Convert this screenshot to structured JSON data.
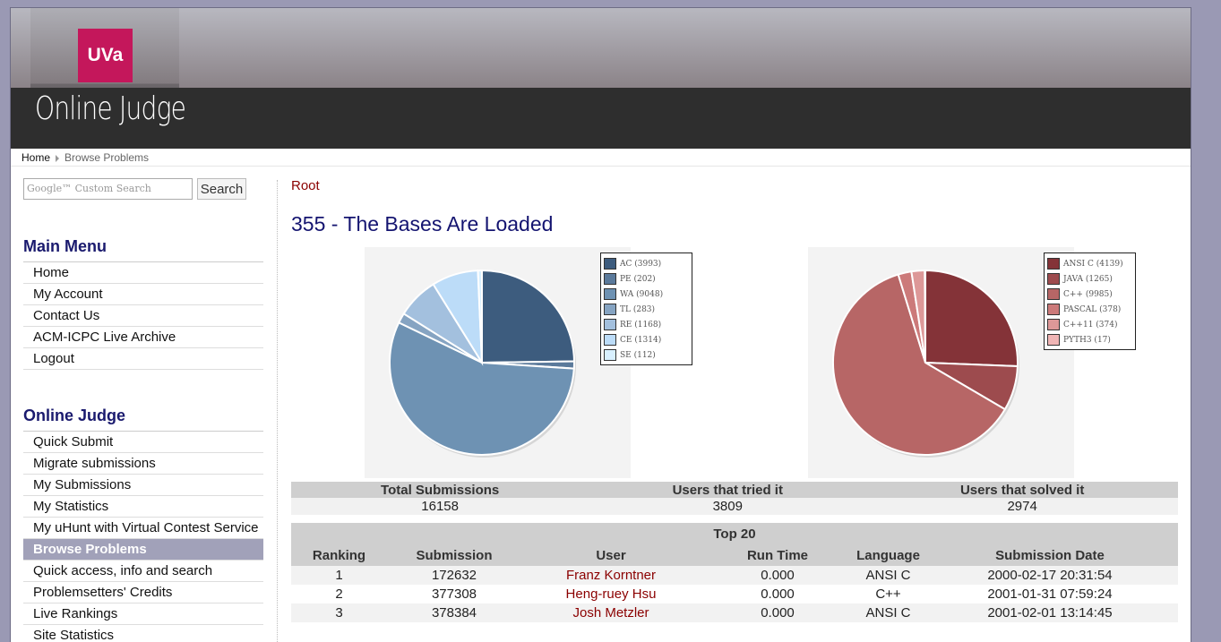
{
  "header": {
    "uva_logo": "UVa",
    "site_name": "Online Judge"
  },
  "breadcrumb": {
    "home": "Home",
    "current": "Browse Problems"
  },
  "search": {
    "placeholder": "Google™ Custom Search",
    "button": "Search"
  },
  "main_menu": {
    "title": "Main Menu",
    "items": [
      "Home",
      "My Account",
      "Contact Us",
      "ACM-ICPC Live Archive",
      "Logout"
    ]
  },
  "online_judge_menu": {
    "title": "Online Judge",
    "items": [
      "Quick Submit",
      "Migrate submissions",
      "My Submissions",
      "My Statistics",
      "My uHunt with Virtual Contest Service",
      "Browse Problems",
      "Quick access, info and search",
      "Problemsetters' Credits",
      "Live Rankings",
      "Site Statistics"
    ],
    "active_index": 5
  },
  "content": {
    "root_link": "Root",
    "problem_title": "355 - The Bases Are Loaded"
  },
  "chart_data": [
    {
      "type": "pie",
      "series": [
        {
          "label": "AC (3993)",
          "value": 3993,
          "color": "#3d5c7e"
        },
        {
          "label": "PE (202)",
          "value": 202,
          "color": "#5b7a9b"
        },
        {
          "label": "WA (9048)",
          "value": 9048,
          "color": "#6e92b3"
        },
        {
          "label": "TL (283)",
          "value": 283,
          "color": "#86a4c2"
        },
        {
          "label": "RE (1168)",
          "value": 1168,
          "color": "#a3c0de"
        },
        {
          "label": "CE (1314)",
          "value": 1314,
          "color": "#bcdcf8"
        },
        {
          "label": "SE (112)",
          "value": 112,
          "color": "#d8f0ff"
        }
      ]
    },
    {
      "type": "pie",
      "series": [
        {
          "label": "ANSI C (4139)",
          "value": 4139,
          "color": "#843338"
        },
        {
          "label": "JAVA (1265)",
          "value": 1265,
          "color": "#9d4b4e"
        },
        {
          "label": "C++ (9985)",
          "value": 9985,
          "color": "#b76666"
        },
        {
          "label": "PASCAL (378)",
          "value": 378,
          "color": "#cc7a7a"
        },
        {
          "label": "C++11 (374)",
          "value": 374,
          "color": "#dd9898"
        },
        {
          "label": "PYTH3 (17)",
          "value": 17,
          "color": "#f0b5b5"
        }
      ]
    }
  ],
  "stats": {
    "headers": [
      "Total Submissions",
      "Users that tried it",
      "Users that solved it"
    ],
    "values": [
      "16158",
      "3809",
      "2974"
    ]
  },
  "top20": {
    "title": "Top 20",
    "headers": [
      "Ranking",
      "Submission",
      "User",
      "Run Time",
      "Language",
      "Submission Date"
    ],
    "rows": [
      [
        "1",
        "172632",
        "Franz Korntner",
        "0.000",
        "ANSI C",
        "2000-02-17 20:31:54"
      ],
      [
        "2",
        "377308",
        "Heng-ruey Hsu",
        "0.000",
        "C++",
        "2001-01-31 07:59:24"
      ],
      [
        "3",
        "378384",
        "Josh Metzler",
        "0.000",
        "ANSI C",
        "2001-02-01 13:14:45"
      ]
    ]
  }
}
